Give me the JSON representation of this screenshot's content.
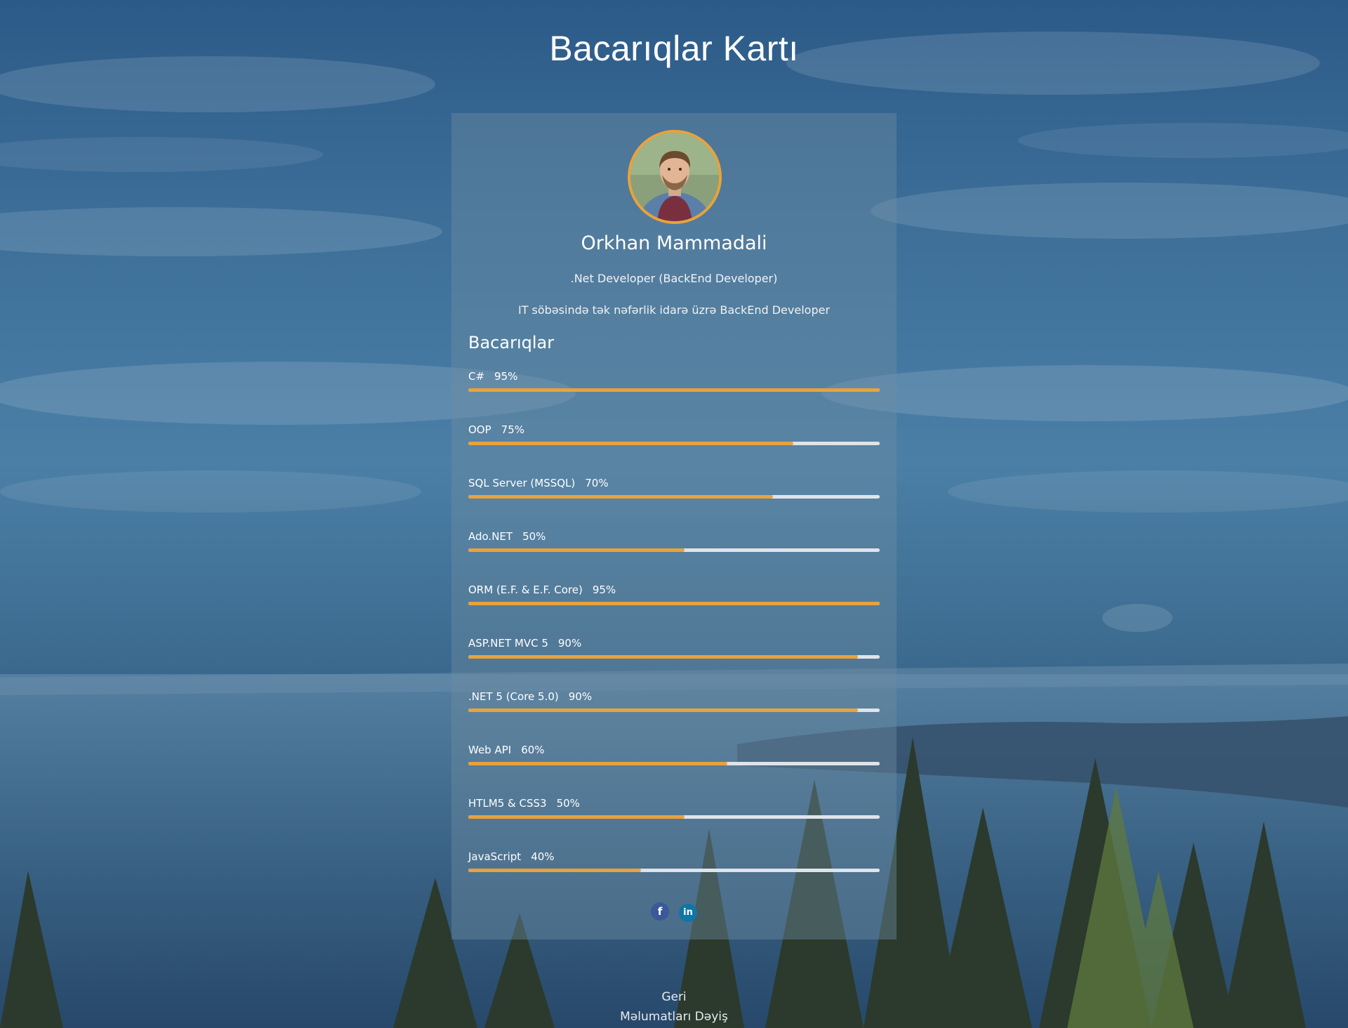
{
  "page": {
    "title": "Bacarıqlar Kartı"
  },
  "profile": {
    "name": "Orkhan Mammadali",
    "role": ".Net Developer (BackEnd Developer)",
    "description": "IT söbəsində tək nəfərlik idarə üzrə BackEnd Developer",
    "avatar_icon": "profile-photo"
  },
  "skills": {
    "heading": "Bacarıqlar",
    "items": [
      {
        "name": "C#",
        "percent": "95%",
        "level": 1.0
      },
      {
        "name": "OOP",
        "percent": "75%",
        "level": 0.79
      },
      {
        "name": "SQL Server (MSSQL)",
        "percent": "70%",
        "level": 0.74
      },
      {
        "name": "Ado.NET",
        "percent": "50%",
        "level": 0.525
      },
      {
        "name": "ORM (E.F. & E.F. Core)",
        "percent": "95%",
        "level": 1.0
      },
      {
        "name": "ASP.NET MVC 5",
        "percent": "90%",
        "level": 0.947
      },
      {
        "name": ".NET 5 (Core 5.0)",
        "percent": "90%",
        "level": 0.947
      },
      {
        "name": "Web API",
        "percent": "60%",
        "level": 0.63
      },
      {
        "name": "HTLM5 & CSS3",
        "percent": "50%",
        "level": 0.525
      },
      {
        "name": "JavaScript",
        "percent": "40%",
        "level": 0.42
      }
    ]
  },
  "social": {
    "facebook_glyph": "f",
    "linkedin_glyph": "in"
  },
  "footer": {
    "back_label": "Geri",
    "edit_label": "Məlumatları Dəyiş"
  },
  "colors": {
    "accent": "#e9a23b",
    "track": "#dfe4ea",
    "facebook": "#3b5998",
    "linkedin": "#0e76a8"
  }
}
